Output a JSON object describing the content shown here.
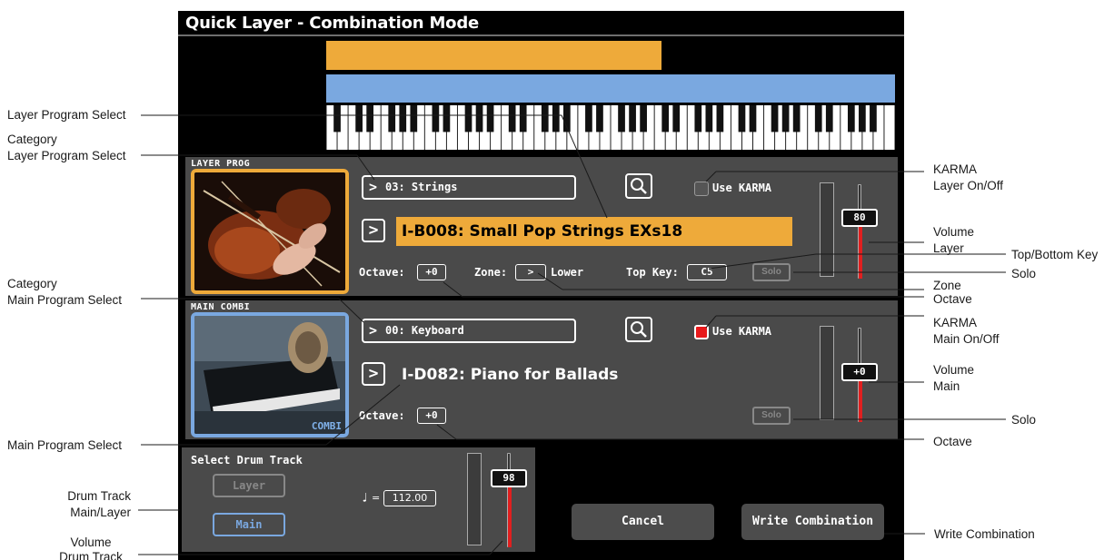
{
  "window": {
    "title": "Quick Layer - Combination Mode"
  },
  "colors": {
    "layer_accent": "#eeaa3a",
    "main_accent": "#7aa8e0",
    "karma_on": "#e8191b",
    "slider_red": "#e01f1f"
  },
  "layer": {
    "tag": "LAYER PROG",
    "category": "03: Strings",
    "program": "I-B008: Small Pop Strings EXs18",
    "use_karma_label": "Use KARMA",
    "use_karma_checked": false,
    "octave_label": "Octave:",
    "octave": "+0",
    "zone_label": "Zone:",
    "zone_value": "Lower",
    "top_key_label": "Top Key:",
    "top_key": "C5",
    "solo_label": "Solo",
    "volume": "80"
  },
  "main": {
    "tag": "MAIN COMBI",
    "image_caption": "COMBI",
    "category": "00: Keyboard",
    "program": "I-D082: Piano for Ballads",
    "use_karma_label": "Use KARMA",
    "use_karma_checked": true,
    "octave_label": "Octave:",
    "octave": "+0",
    "solo_label": "Solo",
    "volume": "+0"
  },
  "drum": {
    "title": "Select Drum Track",
    "layer_label": "Layer",
    "main_label": "Main",
    "selected": "Main",
    "tempo_eq": "=",
    "tempo": "112.00",
    "volume": "98"
  },
  "buttons": {
    "cancel": "Cancel",
    "write": "Write Combination"
  },
  "callouts": {
    "layer_program_select": "Layer Program Select",
    "category_layer_1": "Category",
    "category_layer_2": "Layer Program Select",
    "category_main_1": "Category",
    "category_main_2": "Main Program Select",
    "main_program_select": "Main Program Select",
    "drum_track_1": "Drum Track",
    "drum_track_2": "Main/Layer",
    "volume_drum_1": "Volume",
    "volume_drum_2": "Drum Track",
    "karma_layer_1": "KARMA",
    "karma_layer_2": "Layer On/Off",
    "volume_layer_1": "Volume",
    "volume_layer_2": "Layer",
    "top_bottom_key": "Top/Bottom Key",
    "solo_layer": "Solo",
    "zone": "Zone",
    "octave_layer": "Octave",
    "karma_main_1": "KARMA",
    "karma_main_2": "Main On/Off",
    "volume_main_1": "Volume",
    "volume_main_2": "Main",
    "solo_main": "Solo",
    "octave_main": "Octave",
    "write_combination": "Write Combination"
  }
}
